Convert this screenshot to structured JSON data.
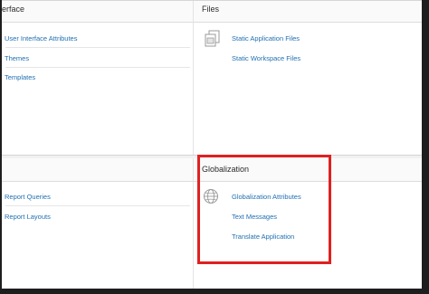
{
  "panels": {
    "user_interface": {
      "title": "erface",
      "links": [
        "User Interface Attributes",
        "Themes",
        "Templates"
      ]
    },
    "files": {
      "title": "Files",
      "icon": "files-icon",
      "links": [
        "Static Application Files",
        "Static Workspace Files"
      ]
    },
    "reports": {
      "title": "",
      "links": [
        "Report Queries",
        "Report Layouts"
      ]
    },
    "globalization": {
      "title": "Globalization",
      "icon": "globe-icon",
      "links": [
        "Globalization Attributes",
        "Text Messages",
        "Translate Application"
      ]
    }
  },
  "colors": {
    "link": "#1f6fb2",
    "highlight": "#e02020",
    "frame": "#1e1e1e"
  }
}
